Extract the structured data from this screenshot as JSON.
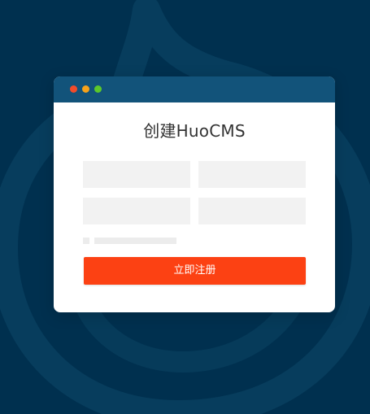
{
  "page": {
    "background_color": "#00304f",
    "decoration_color": "#08405f"
  },
  "card": {
    "title": "创建HuoCMS",
    "titlebar_color": "#12537a",
    "window_dots": [
      "#f24b2a",
      "#f6a21a",
      "#5cc82a"
    ]
  },
  "form": {
    "fields": [
      {
        "value": "",
        "placeholder": ""
      },
      {
        "value": "",
        "placeholder": ""
      },
      {
        "value": "",
        "placeholder": ""
      },
      {
        "value": "",
        "placeholder": ""
      }
    ],
    "agree_checked": false,
    "submit_label": "立即注册",
    "submit_color": "#fc4113"
  }
}
